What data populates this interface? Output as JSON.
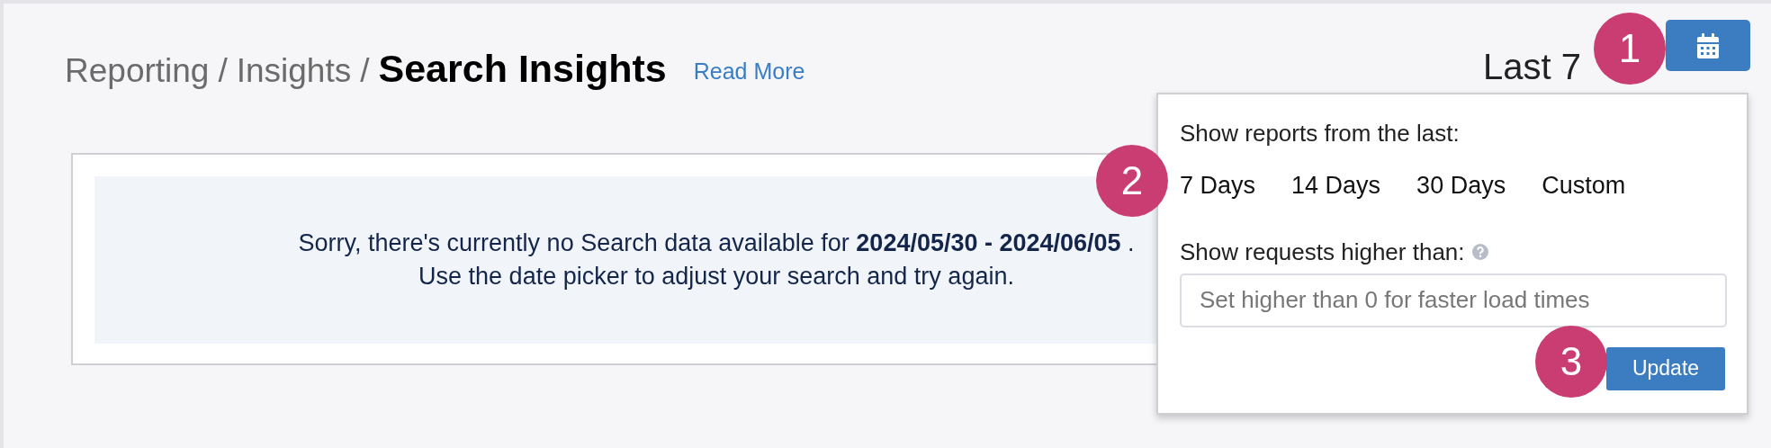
{
  "breadcrumb": {
    "path": [
      "Reporting",
      "Insights"
    ],
    "separator": "/",
    "current": "Search Insights"
  },
  "read_more": "Read More",
  "date_range": {
    "label": "Last 7"
  },
  "message": {
    "line_1": "Sorry, there's currently no Search data available for **2024/05/30 - 2024/06/05** .",
    "line_2": "Use the date picker to adjust your search and try again."
  },
  "popup": {
    "range_label": "Show reports from the last:",
    "ranges": [
      {
        "label": "7 Days",
        "selected": false
      },
      {
        "label": "14 Days",
        "selected": false
      },
      {
        "label": "30 Days",
        "selected": false
      },
      {
        "label": "Custom",
        "selected": false
      }
    ],
    "threshold_label": "Show requests higher than:",
    "threshold_placeholder": "Set higher than 0 for faster load times",
    "update_button": "Update"
  },
  "callouts": [
    "1",
    "2",
    "3"
  ]
}
